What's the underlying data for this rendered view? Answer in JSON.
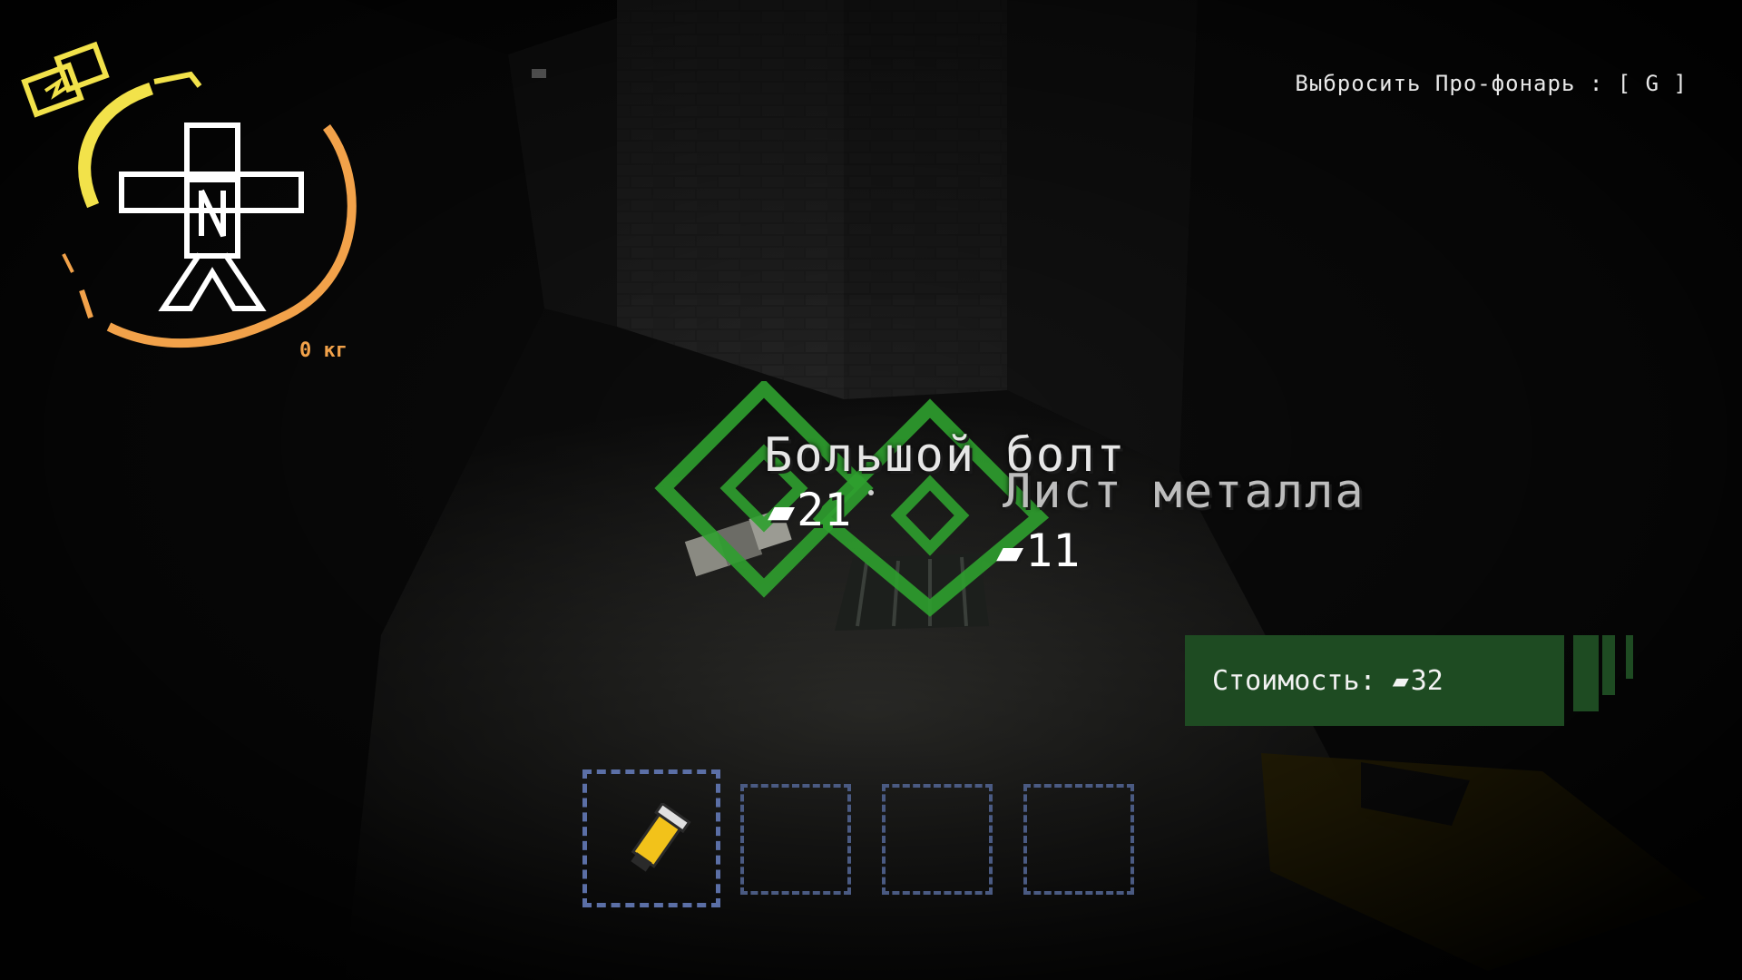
{
  "hud": {
    "drop_hint": "Выбросить Про-фонарь : [ G ]",
    "weight": "0 кг"
  },
  "scanned_items": [
    {
      "name": "Большой болт",
      "price": "21"
    },
    {
      "name": "Лист металла",
      "price": "11"
    }
  ],
  "value_panel": {
    "label": "Стоимость:",
    "amount": "32"
  },
  "inventory": {
    "selected_index": 0,
    "slots": [
      {
        "item": "pro-flashlight"
      },
      {
        "item": ""
      },
      {
        "item": ""
      },
      {
        "item": ""
      }
    ]
  },
  "colors": {
    "scan_green": "#2fa02f",
    "value_panel": "#1e4b22",
    "health_orange": "#f2a24a",
    "stamina_yellow": "#f2e24a",
    "slot_blue": "#4a5a82"
  }
}
